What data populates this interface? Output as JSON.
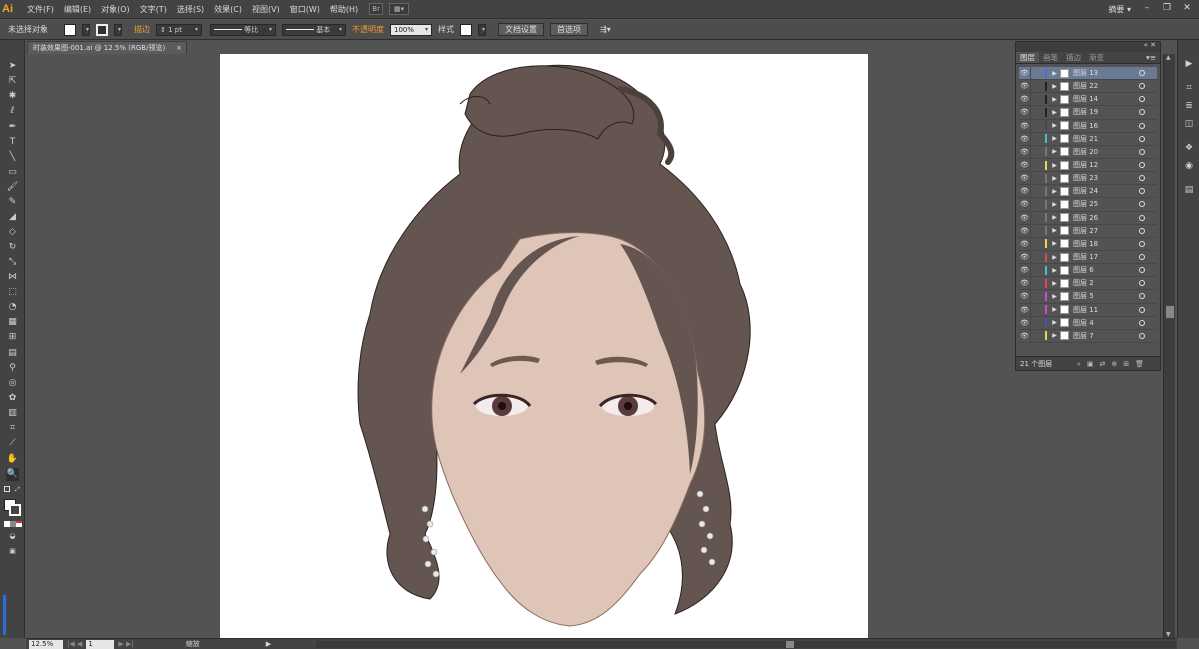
{
  "app": {
    "logo": "Ai",
    "workspace": "摘要 ▾"
  },
  "menu": [
    "文件(F)",
    "编辑(E)",
    "对象(O)",
    "文字(T)",
    "选择(S)",
    "效果(C)",
    "视图(V)",
    "窗口(W)",
    "帮助(H)"
  ],
  "window_controls": [
    "–",
    "❐",
    "✕"
  ],
  "controlbar": {
    "selection": "未选择对象",
    "stroke_label": "描边",
    "stroke_weight": "1 pt",
    "profile": "等比",
    "brush": "基本",
    "opacity_label": "不透明度",
    "opacity_value": "100%",
    "style_label": "样式",
    "doc_setup": "文档设置",
    "prefs": "首选项"
  },
  "document": {
    "tab_title": "时装效果图-001.ai @ 12.5% (RGB/预览)",
    "close": "×"
  },
  "status": {
    "zoom": "12.5%",
    "page": "1",
    "info": "缩放"
  },
  "layers_panel": {
    "tabs": [
      "图层",
      "画笔",
      "描边",
      "渐变"
    ],
    "active_tab": "图层",
    "count_label": "21 个图层",
    "layers": [
      {
        "name": "图层 13",
        "color": "#4b6fd6",
        "selected": true
      },
      {
        "name": "图层 22",
        "color": "#222222"
      },
      {
        "name": "图层 14",
        "color": "#222222"
      },
      {
        "name": "图层 19",
        "color": "#222222"
      },
      {
        "name": "图层 16",
        "color": "#444444"
      },
      {
        "name": "图层 21",
        "color": "#3fc3c8"
      },
      {
        "name": "图层 20",
        "color": "#777777"
      },
      {
        "name": "图层 12",
        "color": "#e8d84b"
      },
      {
        "name": "图层 23",
        "color": "#777777"
      },
      {
        "name": "图层 24",
        "color": "#777777"
      },
      {
        "name": "图层 25",
        "color": "#777777"
      },
      {
        "name": "图层 26",
        "color": "#777777"
      },
      {
        "name": "图层 27",
        "color": "#777777"
      },
      {
        "name": "图层 18",
        "color": "#e8d84b"
      },
      {
        "name": "图层 17",
        "color": "#d64b4b"
      },
      {
        "name": "图层 6",
        "color": "#3fc3c8"
      },
      {
        "name": "图层 2",
        "color": "#d64b4b"
      },
      {
        "name": "图层 5",
        "color": "#c94bd6"
      },
      {
        "name": "图层 11",
        "color": "#c94bd6"
      },
      {
        "name": "图层 4",
        "color": "#4b4bd6"
      },
      {
        "name": "图层 7",
        "color": "#e8d84b"
      }
    ]
  },
  "colors": {
    "hair": "#655550",
    "skin": "#dfc4b8",
    "accent": "#f29a36"
  }
}
